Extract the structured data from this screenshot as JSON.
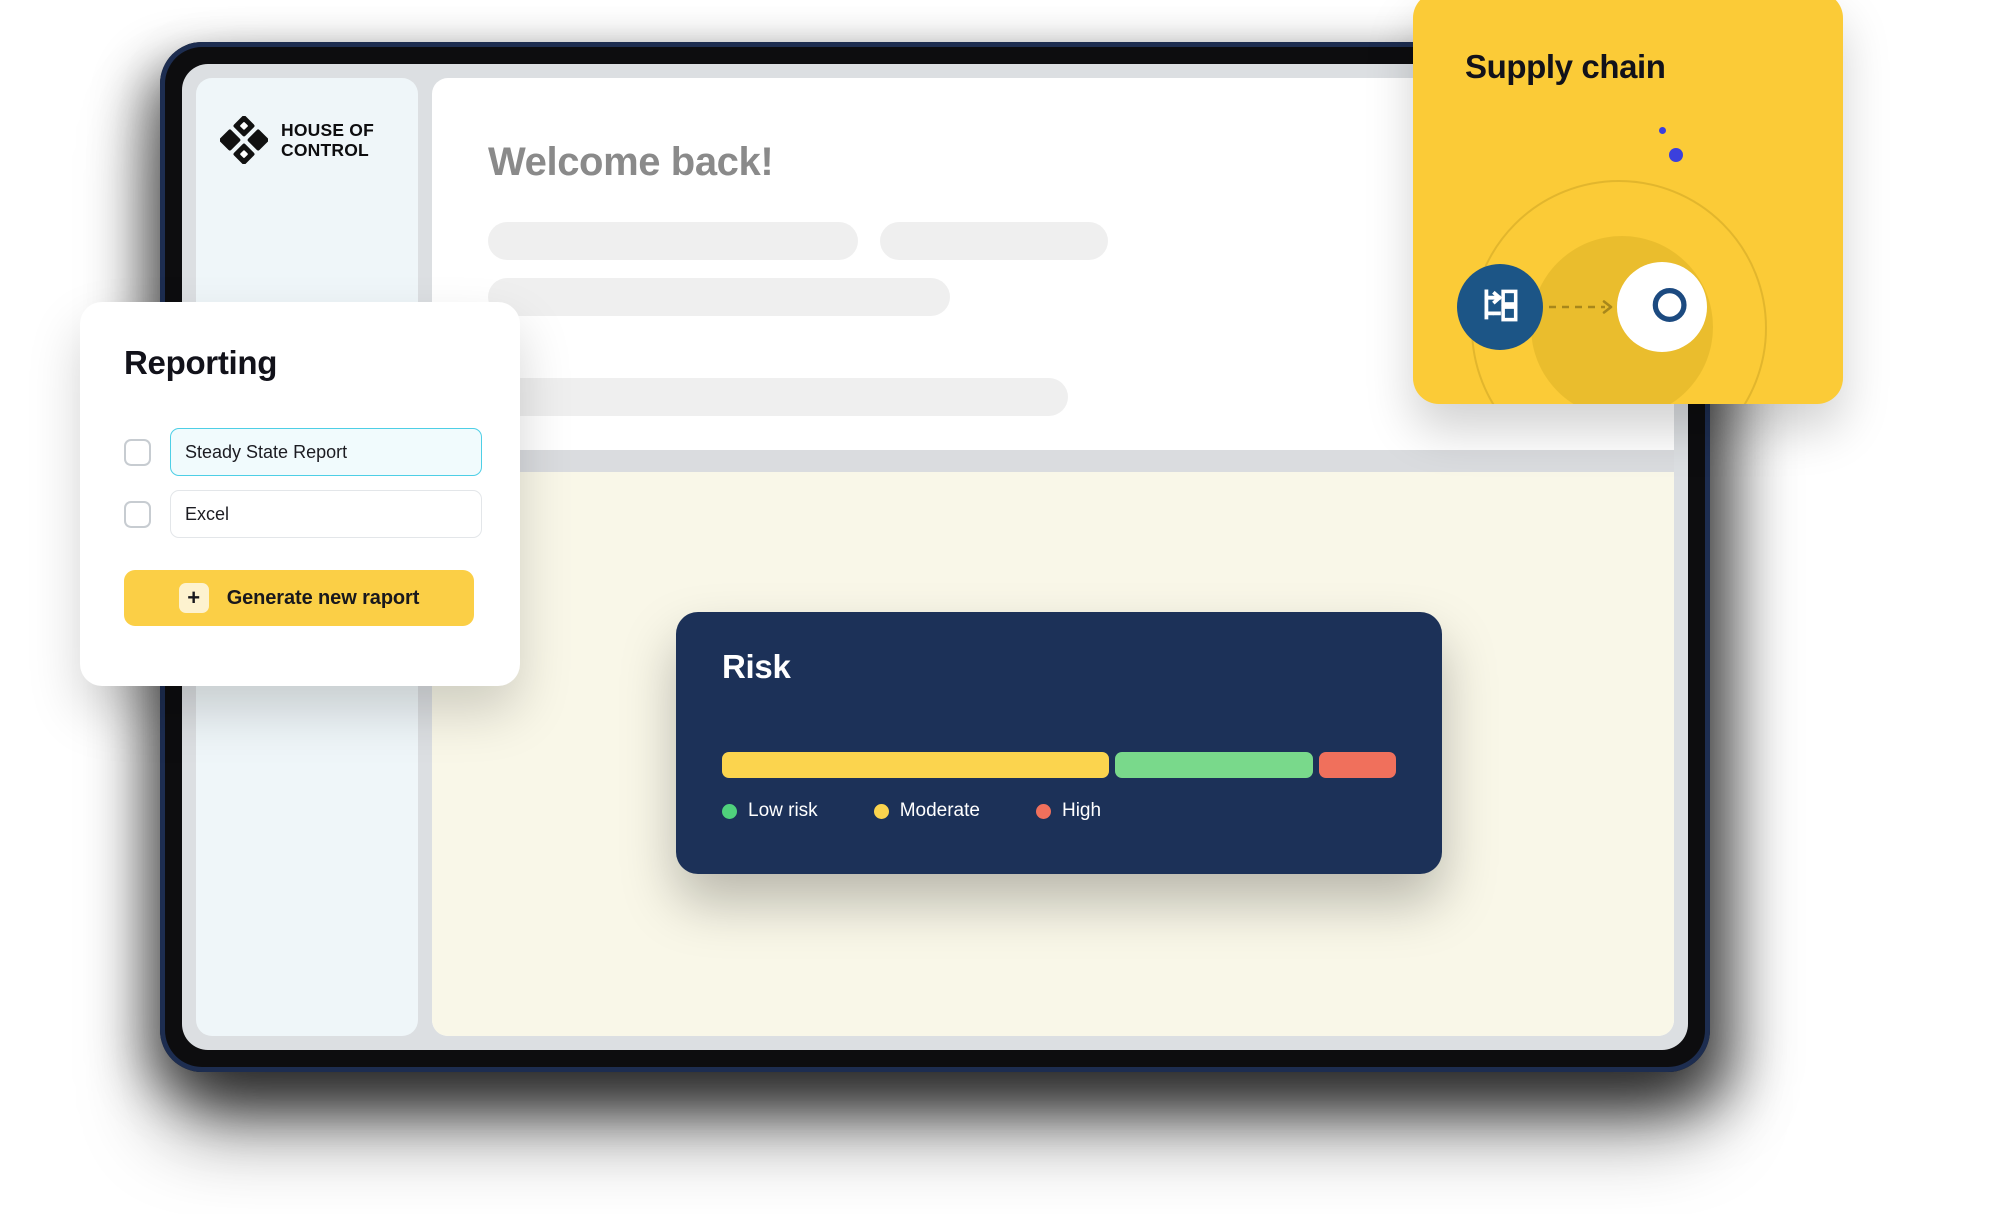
{
  "device": {
    "name": "tablet-device",
    "frame_color": "#0d0d0f",
    "inner_edge_color": "#1d2d50",
    "screen_bg": "#dcdfe2"
  },
  "app": {
    "sidebar": {
      "brand_name": "HOUSE OF\nCONTROL",
      "logo_icon": "house-of-control-logo-icon",
      "bg": "#eff6f9"
    },
    "main": {
      "welcome_title": "Welcome back!",
      "title_color": "#8a8a8a",
      "skeleton_placeholders": [
        {
          "name": "skeleton-line-1",
          "class": "sk-1"
        },
        {
          "name": "skeleton-line-2",
          "class": "sk-2"
        },
        {
          "name": "skeleton-line-3",
          "class": "sk-3"
        },
        {
          "name": "skeleton-line-4",
          "class": "sk-4"
        }
      ],
      "divider_color": "#dadcdf",
      "lower_panel_color": "#f9f7e8"
    }
  },
  "cards": {
    "supply_chain": {
      "title": "Supply chain",
      "bg": "#fbcb37",
      "left_node_icon": "workflow-flowchart-icon",
      "left_node_color": "#1c5586",
      "connector_icon": "dashed-arrow-icon",
      "right_node_icon": "co-brand-logo-icon",
      "right_node_bg": "#ffffff",
      "accent_dot_color": "#3b40dd"
    },
    "reporting": {
      "title": "Reporting",
      "rows": [
        {
          "checkbox_name": "report-checkbox-steady-state",
          "checked": false,
          "value": "Steady State Report",
          "focused": true
        },
        {
          "checkbox_name": "report-checkbox-excel",
          "checked": false,
          "value": "Excel",
          "focused": false
        }
      ],
      "button": {
        "label": "Generate new raport",
        "plus_icon": "plus-icon",
        "bg": "#fbcf46"
      },
      "focus_border_color": "#4ecfe6"
    },
    "risk": {
      "title": "Risk",
      "bg": "#1c3158",
      "segments": [
        {
          "name": "moderate",
          "color": "#fbd44e",
          "flex": 55
        },
        {
          "name": "low-risk",
          "color": "#79d98b",
          "flex": 28
        },
        {
          "name": "high",
          "color": "#f0705c",
          "flex": 11
        }
      ],
      "legend": [
        {
          "label": "Low risk",
          "color": "#4fd17c"
        },
        {
          "label": "Moderate",
          "color": "#fbd44e"
        },
        {
          "label": "High",
          "color": "#f0705c"
        }
      ]
    }
  }
}
